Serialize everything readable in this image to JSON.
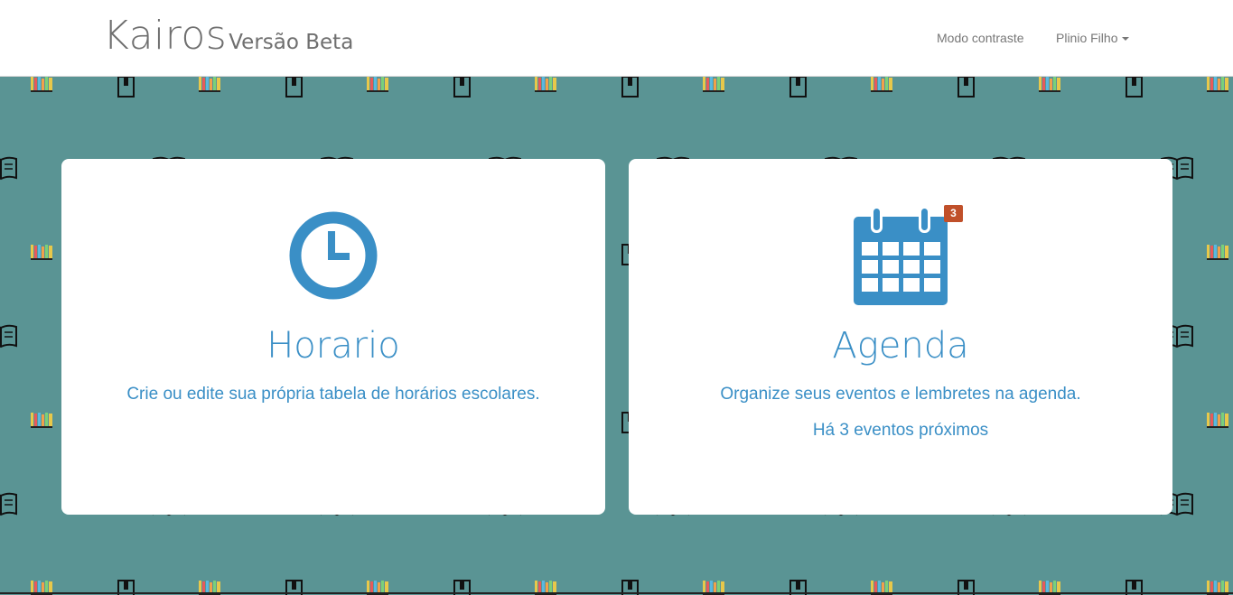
{
  "app": {
    "brand": "Kairos",
    "version_label": "Versão Beta"
  },
  "nav": {
    "contrast_label": "Modo contraste",
    "user_label": "Plinio Filho"
  },
  "cards": {
    "horario": {
      "title": "Horario",
      "description": "Crie ou edite sua própria tabela de horários escolares.",
      "icon": "clock-icon"
    },
    "agenda": {
      "title": "Agenda",
      "description": "Organize seus eventos e lembretes na agenda.",
      "upcoming_text": "Há 3 eventos próximos",
      "badge_count": "3",
      "icon": "calendar-icon"
    }
  },
  "colors": {
    "background": "#5a9494",
    "accent": "#3a8fc6",
    "badge": "#c0502a",
    "navbar": "#ffffff"
  }
}
